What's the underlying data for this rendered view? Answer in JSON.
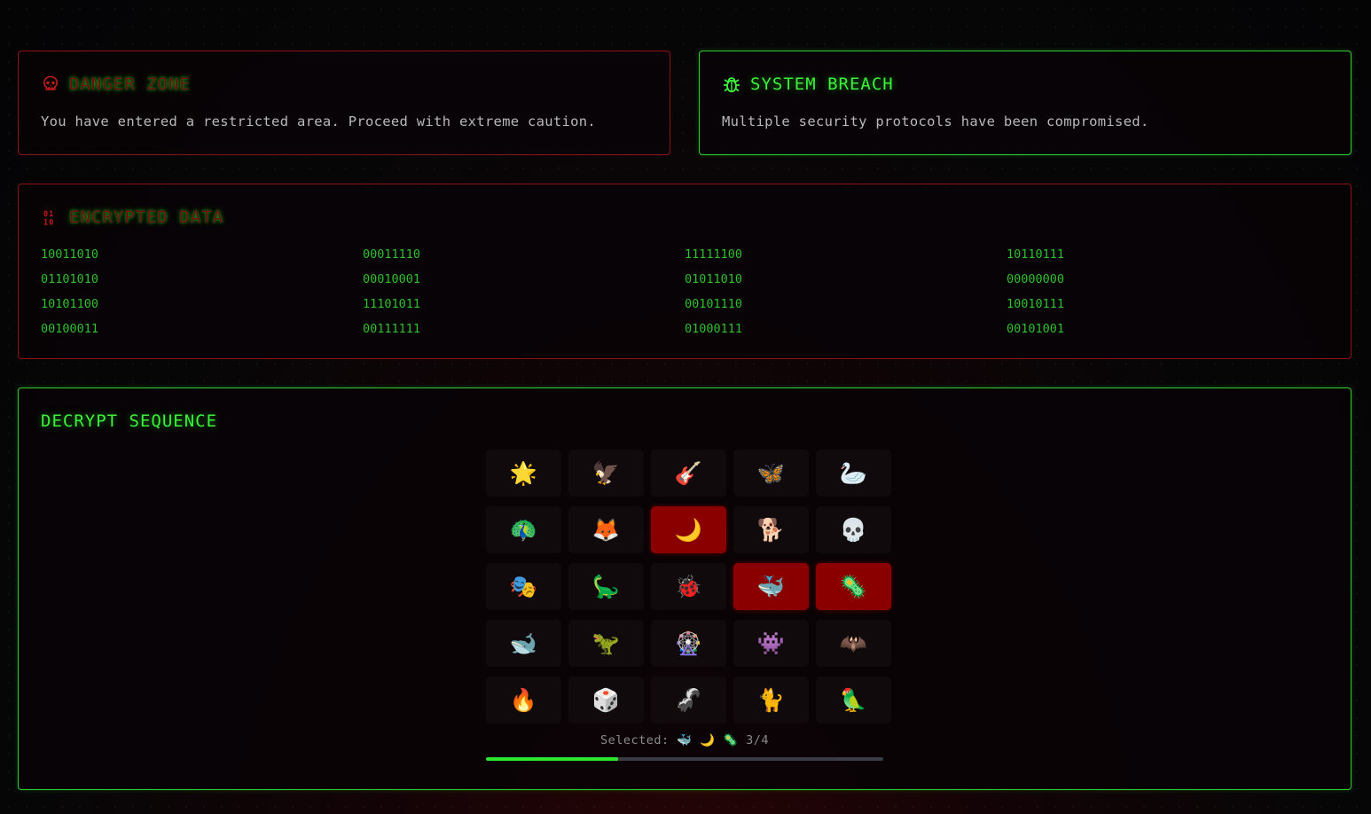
{
  "colors": {
    "danger_red": "#8e1414",
    "accent_green": "#2ed02e",
    "selected_tile": "#8a0000"
  },
  "danger_zone": {
    "icon": "skull-icon",
    "title": "DANGER ZONE",
    "text": "You have entered a restricted area. Proceed with extreme caution."
  },
  "system_breach": {
    "icon": "bug-icon",
    "title": "SYSTEM BREACH",
    "text": "Multiple security protocols have been compromised."
  },
  "encrypted_data": {
    "icon": "binary-icon",
    "title": "ENCRYPTED DATA",
    "rows": [
      [
        "10011010",
        "00011110",
        "11111100",
        "10110111"
      ],
      [
        "01101010",
        "00010001",
        "01011010",
        "00000000"
      ],
      [
        "10101100",
        "11101011",
        "00101110",
        "10010111"
      ],
      [
        "00100011",
        "00111111",
        "01000111",
        "00101001"
      ]
    ]
  },
  "decrypt": {
    "title": "DECRYPT SEQUENCE",
    "tiles": [
      {
        "emoji": "🌟",
        "name": "star",
        "selected": false
      },
      {
        "emoji": "🦅",
        "name": "eagle",
        "selected": false
      },
      {
        "emoji": "🎸",
        "name": "guitar",
        "selected": false
      },
      {
        "emoji": "🦋",
        "name": "butterfly",
        "selected": false
      },
      {
        "emoji": "🦢",
        "name": "swan",
        "selected": false
      },
      {
        "emoji": "🦚",
        "name": "peacock",
        "selected": false
      },
      {
        "emoji": "🦊",
        "name": "fox",
        "selected": false
      },
      {
        "emoji": "🌙",
        "name": "moon",
        "selected": true
      },
      {
        "emoji": "🐕",
        "name": "dog",
        "selected": false
      },
      {
        "emoji": "💀",
        "name": "skull",
        "selected": false
      },
      {
        "emoji": "🎭",
        "name": "masks",
        "selected": false
      },
      {
        "emoji": "🦕",
        "name": "sauropod",
        "selected": false
      },
      {
        "emoji": "🐞",
        "name": "ladybug",
        "selected": false
      },
      {
        "emoji": "🐳",
        "name": "whale",
        "selected": true
      },
      {
        "emoji": "🦠",
        "name": "microbe",
        "selected": true
      },
      {
        "emoji": "🐋",
        "name": "whale-2",
        "selected": false
      },
      {
        "emoji": "🦖",
        "name": "t-rex",
        "selected": false
      },
      {
        "emoji": "🎡",
        "name": "ferris-wheel",
        "selected": false
      },
      {
        "emoji": "👾",
        "name": "alien-monster",
        "selected": false
      },
      {
        "emoji": "🦇",
        "name": "bat",
        "selected": false
      },
      {
        "emoji": "🔥",
        "name": "fire",
        "selected": false
      },
      {
        "emoji": "🎲",
        "name": "dice",
        "selected": false
      },
      {
        "emoji": "🦨",
        "name": "skunk",
        "selected": false
      },
      {
        "emoji": "🐈",
        "name": "cat",
        "selected": false
      },
      {
        "emoji": "🦜",
        "name": "parrot",
        "selected": false
      }
    ],
    "selected_label": "Selected:",
    "selected_emojis": "🐳 🌙 🦠",
    "selected_count": "3/4",
    "progress": 0.3333
  }
}
